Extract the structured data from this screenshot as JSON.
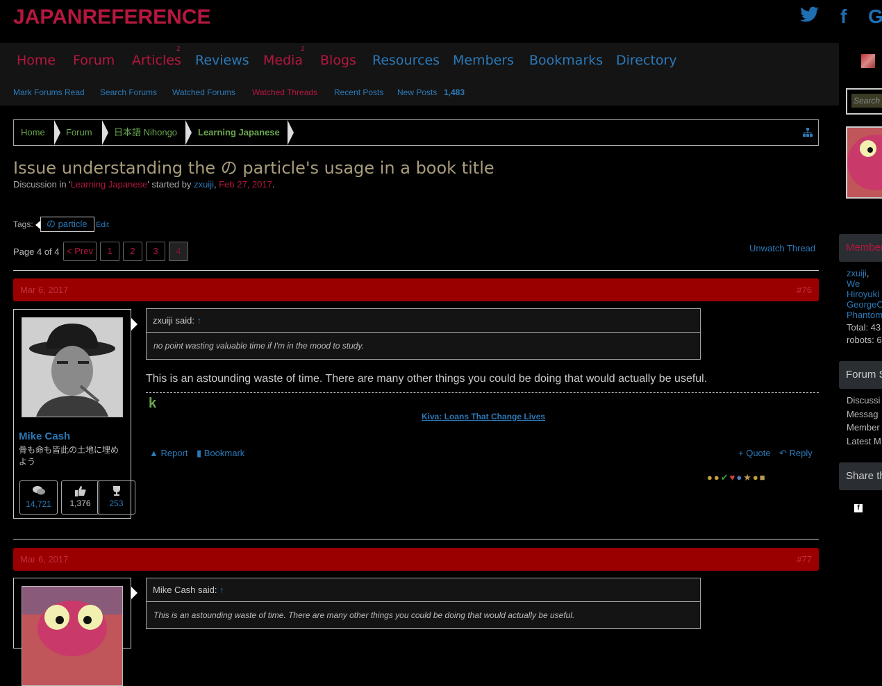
{
  "site": {
    "logo": "JAPANREFERENCE",
    "social": [
      "twitter-icon",
      "facebook-icon",
      "google-icon"
    ],
    "social_glyphs": [
      "🐦",
      "f",
      "G"
    ]
  },
  "nav": {
    "items": [
      {
        "label": "Home",
        "badge": ""
      },
      {
        "label": "Forum",
        "badge": ""
      },
      {
        "label": "Articles",
        "badge": "2"
      },
      {
        "label": "Reviews",
        "badge": ""
      },
      {
        "label": "Media",
        "badge": "2"
      },
      {
        "label": "Blogs",
        "badge": ""
      },
      {
        "label": "Resources",
        "badge": ""
      },
      {
        "label": "Members",
        "badge": ""
      },
      {
        "label": "Bookmarks",
        "badge": ""
      },
      {
        "label": "Directory",
        "badge": ""
      }
    ]
  },
  "subnav": {
    "items": [
      "Mark Forums Read",
      "Search Forums",
      "Watched Forums",
      "Watched Threads",
      "Recent Posts",
      "New Posts"
    ],
    "new_posts_count": "1,483"
  },
  "breadcrumb": [
    "Home",
    "Forum",
    "日本語 Nihongo",
    "Learning Japanese"
  ],
  "thread": {
    "title": "Issue understanding the の particle's usage in a book title",
    "meta_prefix": "Discussion in '",
    "forum": "Learning Japanese",
    "meta_mid": "' started by ",
    "author": "zxuiji",
    "sep": ", ",
    "date": "Feb 27, 2017",
    "end": ".",
    "tags_label": "Tags:",
    "tag": "の particle",
    "tag_edit": "Edit"
  },
  "pagination": {
    "label": "Page 4 of 4",
    "prev": "< Prev",
    "pages": [
      "1",
      "2",
      "3",
      "4"
    ],
    "unwatch": "Unwatch Thread"
  },
  "posts": [
    {
      "date": "Mar 6, 2017",
      "number": "#76",
      "user": "Mike Cash",
      "user_title": "骨も命も皆此の土地に埋めよう",
      "stats": [
        {
          "icon": "messages-icon",
          "glyph": "💬",
          "value": "14,721"
        },
        {
          "icon": "likes-icon",
          "glyph": "👍",
          "value": "1,376"
        },
        {
          "icon": "trophy-icon",
          "glyph": "🏆",
          "value": "253"
        }
      ],
      "quote_author": "zxuiji said:",
      "quote_arrow": "↑",
      "quote_text": "no point wasting valuable time if I'm in the mood to study.",
      "body": "This is an astounding waste of time. There are many other things you could be doing that would actually be useful.",
      "sig_logo": "k",
      "sig_link": "Kiva: Loans That Change Lives",
      "report": "Report",
      "bookmark": "Bookmark",
      "quote_btn": "+ Quote",
      "reply": "Reply"
    },
    {
      "date": "Mar 6, 2017",
      "number": "#77",
      "quote_author": "Mike Cash said:",
      "quote_arrow": "↑",
      "quote_text": "This is an astounding waste of time. There are many other things you could be doing that would actually be useful."
    }
  ],
  "sidebar": {
    "search_placeholder": "Search",
    "members_heading": "Members",
    "members_online": [
      "zxuiji",
      "We",
      "Hiroyuki",
      "GeorgeC",
      "Phantom"
    ],
    "total": "Total: 43",
    "robots": "robots: 6",
    "forum_stats_heading": "Forum S",
    "stats_labels": [
      "Discussi",
      "Messag",
      "Member",
      "Latest M"
    ],
    "share_heading": "Share th"
  },
  "colors": {
    "accent_red": "#b5173f",
    "link_blue": "#2b79b8",
    "post_bar": "#9a0000"
  }
}
